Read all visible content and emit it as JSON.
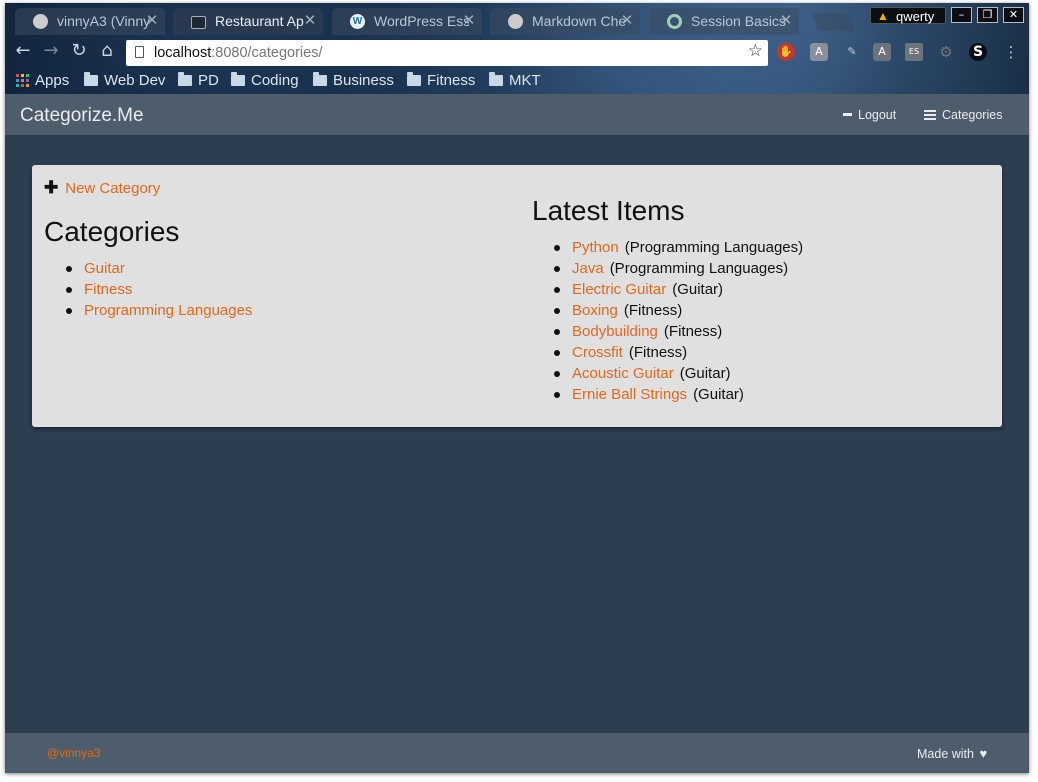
{
  "browser": {
    "tabs": [
      {
        "title": "vinnyA3 (Vinny",
        "icon": "github-icon",
        "active": false
      },
      {
        "title": "Restaurant Ap",
        "icon": "terminal-icon",
        "active": true
      },
      {
        "title": "WordPress Ess",
        "icon": "wordpress-icon",
        "active": false
      },
      {
        "title": "Markdown Che",
        "icon": "github-icon",
        "active": false
      },
      {
        "title": "Session Basics",
        "icon": "circle-icon",
        "active": false
      }
    ],
    "profile_name": "qwerty",
    "url_host": "localhost",
    "url_rest": ":8080/categories/",
    "bookmarks": [
      "Apps",
      "Web Dev",
      "PD",
      "Coding",
      "Business",
      "Fitness",
      "MKT"
    ]
  },
  "navbar": {
    "brand": "Categorize.Me",
    "logout_label": "Logout",
    "categories_label": "Categories"
  },
  "main": {
    "new_category_label": "New Category",
    "categories_heading": "Categories",
    "categories": [
      "Guitar",
      "Fitness",
      "Programming Languages"
    ],
    "latest_heading": "Latest Items",
    "latest_items": [
      {
        "name": "Python",
        "category": "(Programming Languages)"
      },
      {
        "name": "Java",
        "category": "(Programming Languages)"
      },
      {
        "name": "Electric Guitar",
        "category": "(Guitar)"
      },
      {
        "name": "Boxing",
        "category": "(Fitness)"
      },
      {
        "name": "Bodybuilding",
        "category": "(Fitness)"
      },
      {
        "name": "Crossfit",
        "category": "(Fitness)"
      },
      {
        "name": "Acoustic Guitar",
        "category": "(Guitar)"
      },
      {
        "name": "Ernie Ball Strings",
        "category": "(Guitar)"
      }
    ]
  },
  "footer": {
    "left_text": "@vinnya3",
    "right_text": "Made with"
  },
  "colors": {
    "accent": "#df691a",
    "page_bg": "#2c3e50",
    "navbar_bg": "#4e5d6c",
    "card_bg": "#e0e0e0"
  }
}
